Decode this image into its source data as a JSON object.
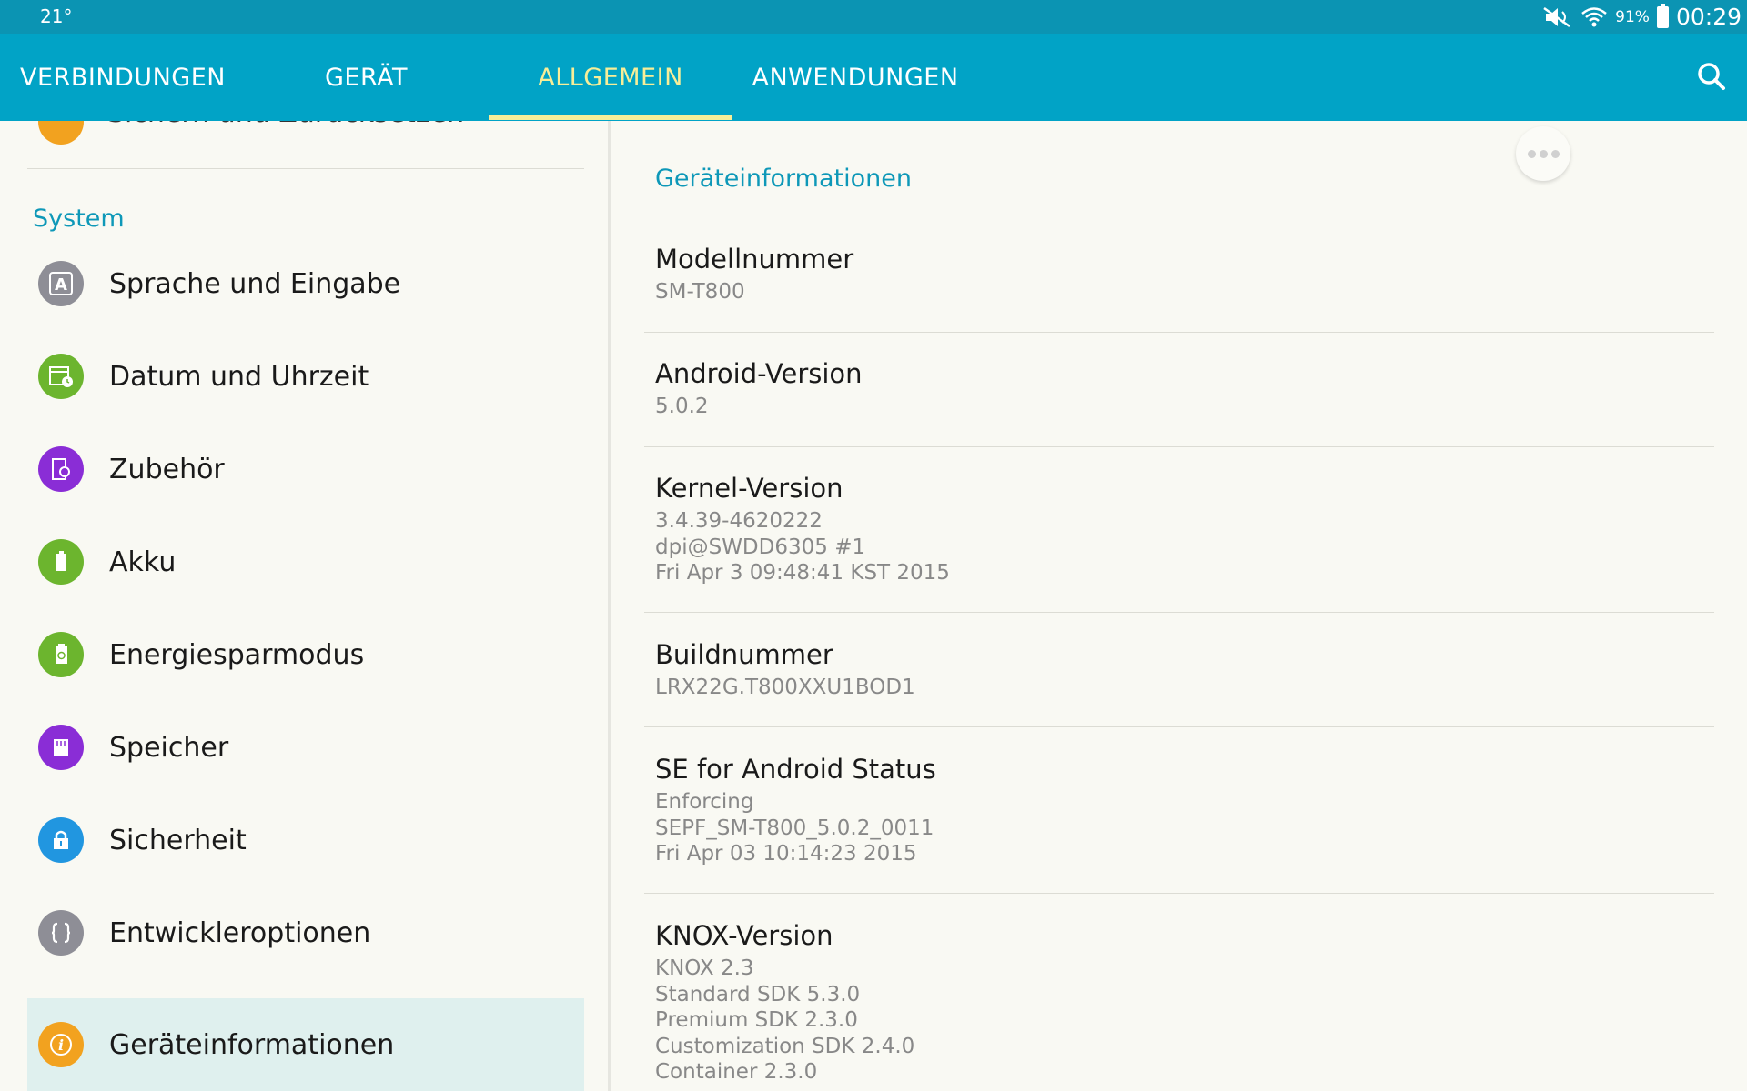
{
  "status_bar": {
    "temperature": "21°",
    "battery_percent": "91%",
    "time": "00:29",
    "battery_level": 0.91
  },
  "tabs": [
    {
      "label": "VERBINDUNGEN"
    },
    {
      "label": "GERÄT"
    },
    {
      "label": "ALLGEMEIN",
      "active": true
    },
    {
      "label": "ANWENDUNGEN"
    }
  ],
  "left": {
    "cut_item": "Sichern und Zurücksetzen",
    "section_header": "System",
    "items": [
      {
        "label": "Sprache und Eingabe",
        "icon": "language-icon",
        "color": "#8e8e96"
      },
      {
        "label": "Datum und Uhrzeit",
        "icon": "calendar-clock-icon",
        "color": "#6cb52e"
      },
      {
        "label": "Zubehör",
        "icon": "accessory-icon",
        "color": "#8a2dd6"
      },
      {
        "label": "Akku",
        "icon": "battery-icon",
        "color": "#6cb52e"
      },
      {
        "label": "Energiesparmodus",
        "icon": "power-saving-icon",
        "color": "#6cb52e"
      },
      {
        "label": "Speicher",
        "icon": "storage-icon",
        "color": "#8a2dd6"
      },
      {
        "label": "Sicherheit",
        "icon": "lock-icon",
        "color": "#2196e0"
      },
      {
        "label": "Entwickleroptionen",
        "icon": "developer-braces-icon",
        "color": "#8e8e96"
      },
      {
        "label": "Geräteinformationen",
        "icon": "info-icon",
        "color": "#f2a21f",
        "active": true
      }
    ]
  },
  "right": {
    "title": "Geräteinformationen",
    "items": [
      {
        "title": "Modellnummer",
        "lines": [
          "SM-T800"
        ]
      },
      {
        "title": "Android-Version",
        "lines": [
          "5.0.2"
        ]
      },
      {
        "title": "Kernel-Version",
        "lines": [
          "3.4.39-4620222",
          "dpi@SWDD6305 #1",
          "Fri Apr 3 09:48:41 KST 2015"
        ]
      },
      {
        "title": "Buildnummer",
        "lines": [
          "LRX22G.T800XXU1BOD1"
        ]
      },
      {
        "title": "SE for Android Status",
        "lines": [
          "Enforcing",
          "SEPF_SM-T800_5.0.2_0011",
          "Fri Apr 03 10:14:23 2015"
        ]
      },
      {
        "title": "KNOX-Version",
        "lines": [
          "KNOX 2.3",
          "Standard SDK 5.3.0",
          "Premium SDK 2.3.0",
          "Customization SDK 2.4.0",
          "Container 2.3.0"
        ]
      }
    ]
  }
}
